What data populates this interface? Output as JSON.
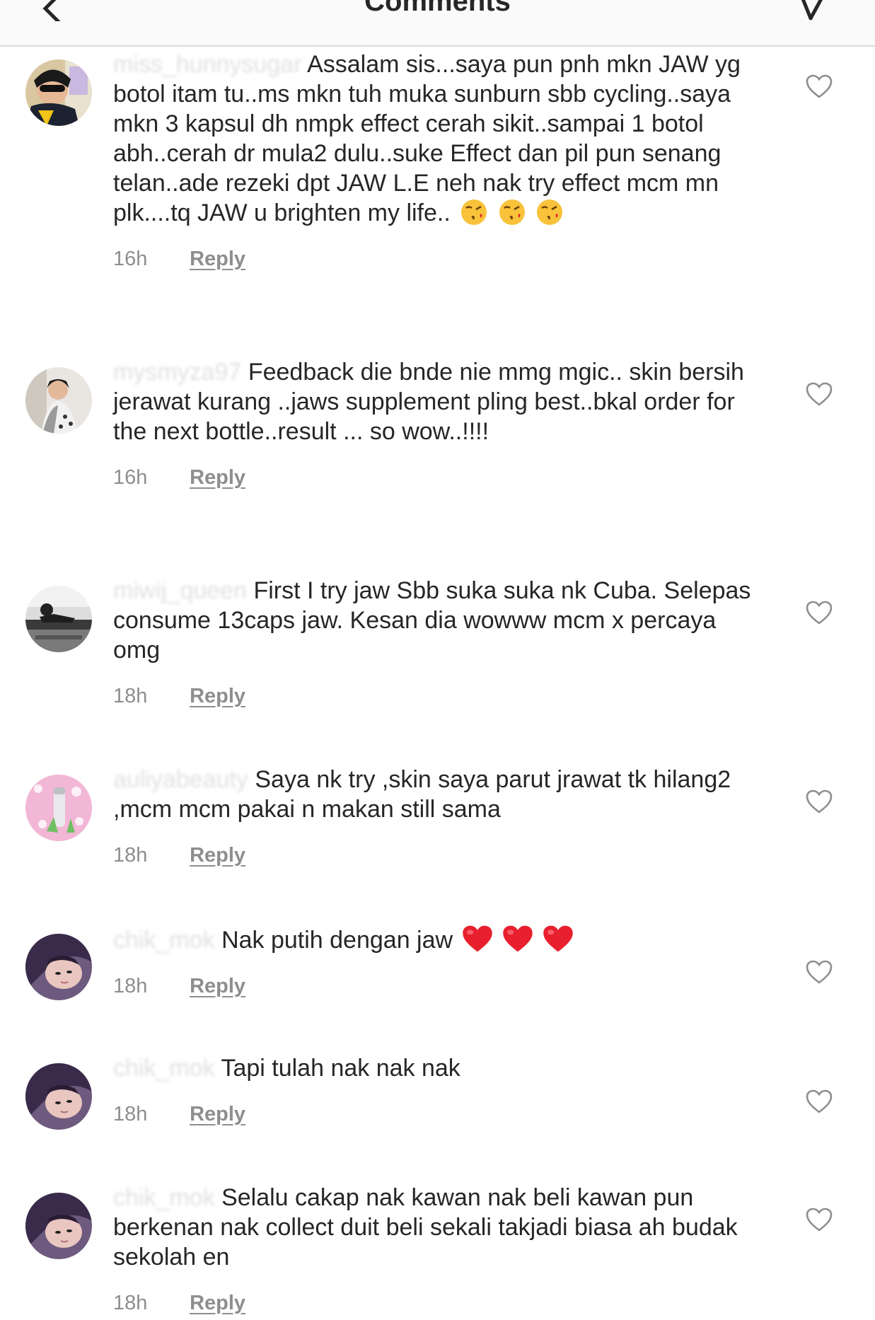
{
  "header": {
    "title": "Comments",
    "back_icon": "chevron-left-icon",
    "send_icon": "paper-plane-icon"
  },
  "colors": {
    "text": "#262626",
    "meta": "#8e8e8e",
    "divider": "#dbdbdb",
    "emoji_heart": "#e8202e"
  },
  "comments": [
    {
      "username": "miss_hunnysugar",
      "text": "Assalam sis...saya pun pnh mkn JAW yg botol itam tu..ms mkn tuh muka sunburn sbb cycling..saya mkn 3 kapsul dh nmpk effect cerah sikit..sampai 1 botol abh..cerah dr mula2 dulu..suke Effect dan pil pun senang telan..ade rezeki dpt JAW L.E neh nak try effect mcm mn plk....tq JAW u brighten my life..",
      "emoji": "face-blowing-kiss x3",
      "time": "16h",
      "reply": "Reply"
    },
    {
      "username": "mysmyza97",
      "text": "Feedback die bnde nie mmg mgic.. skin bersih jerawat kurang ..jaws supplement pling best..bkal order for the next bottle..result ... so wow..!!!!",
      "time": "16h",
      "reply": "Reply"
    },
    {
      "username": "miwij_queen",
      "text": "First I try jaw Sbb suka suka nk Cuba. Selepas consume 13caps jaw. Kesan dia wowww mcm x percaya omg",
      "time": "18h",
      "reply": "Reply"
    },
    {
      "username": "auliyabeauty",
      "text": "Saya nk try ,skin saya parut jrawat tk hilang2 ,mcm mcm pakai n makan still sama",
      "time": "18h",
      "reply": "Reply"
    },
    {
      "username": "chik_mok",
      "text": "Nak putih dengan jaw",
      "emoji": "red-heart x3",
      "time": "18h",
      "reply": "Reply"
    },
    {
      "username": "chik_mok",
      "text": "Tapi tulah nak nak nak",
      "time": "18h",
      "reply": "Reply"
    },
    {
      "username": "chik_mok",
      "text": "Selalu cakap nak kawan nak beli kawan pun berkenan nak collect duit beli sekali takjadi biasa ah budak sekolah en",
      "time": "18h",
      "reply": "Reply"
    }
  ]
}
